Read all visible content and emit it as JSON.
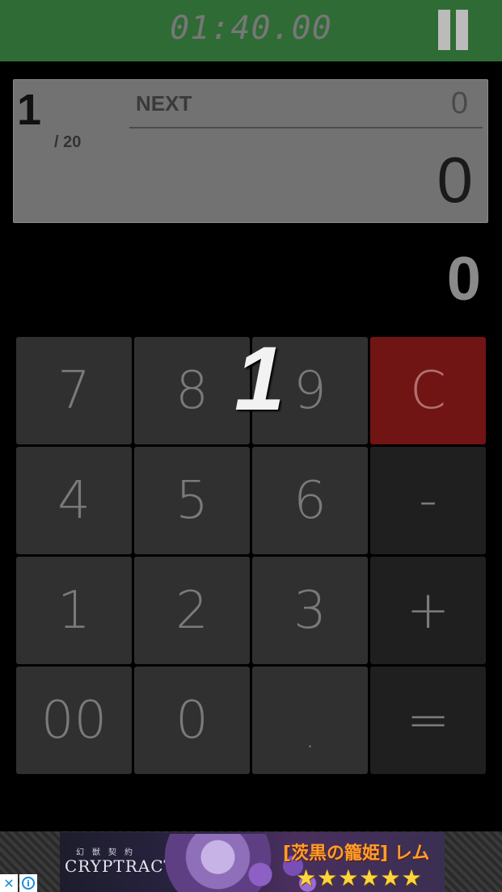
{
  "header": {
    "timer": "01:40.00"
  },
  "question": {
    "current": "1",
    "total": "/ 20"
  },
  "next": {
    "label": "NEXT",
    "value": "0"
  },
  "panel": {
    "target_value": "0"
  },
  "display": {
    "value": "0"
  },
  "keypad": {
    "k7": "7",
    "k8": "8",
    "k9": "9",
    "clear": "C",
    "k4": "4",
    "k5": "5",
    "k6": "6",
    "minus": "-",
    "k1": "1",
    "k2": "2",
    "k3": "3",
    "plus": "+",
    "k00": "00",
    "k0": "0",
    "dot": ".",
    "equals": "="
  },
  "overlay": {
    "number": "1"
  },
  "ad": {
    "kanji": "幻獣契約",
    "brand": "CRYPTRACT",
    "title": "[茨黒の籠姫] レム",
    "stars": "★★★★★★",
    "close": "✕",
    "info": "i"
  },
  "colors": {
    "topbar": "#2f6b35",
    "clear_key": "#711414",
    "panel": "#727272"
  }
}
